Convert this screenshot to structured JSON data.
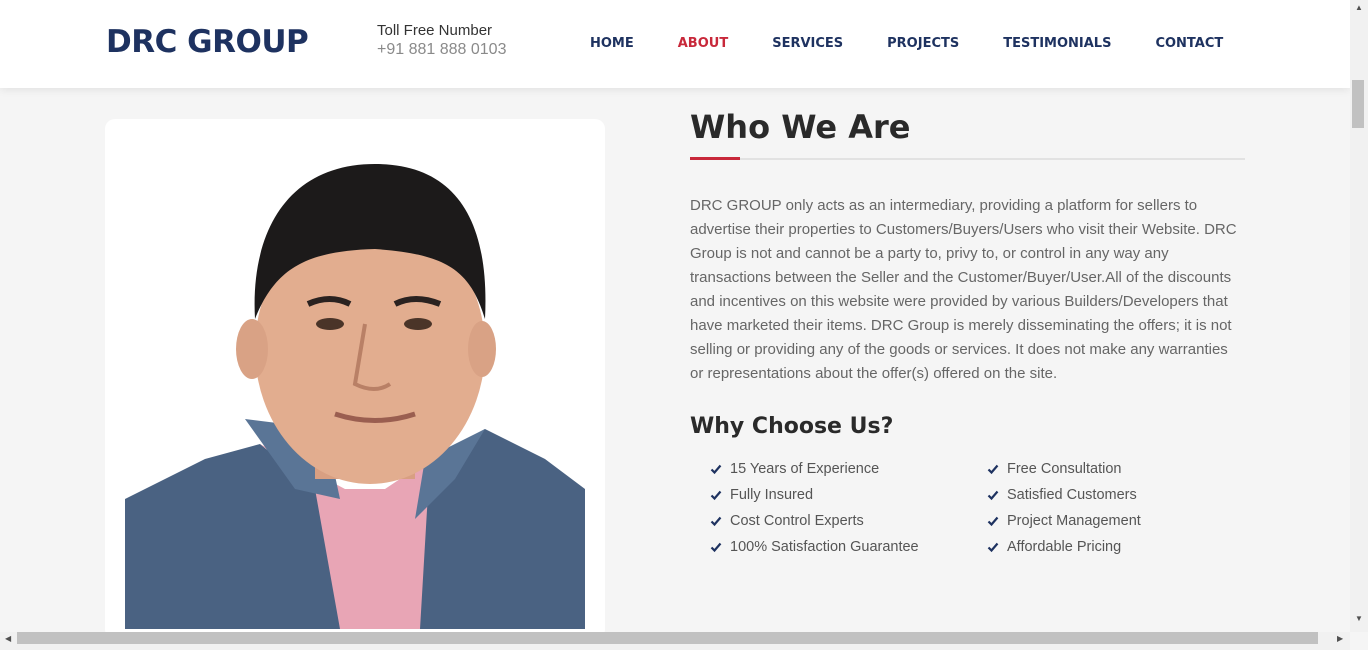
{
  "header": {
    "logo": "DRC GROUP",
    "toll_label": "Toll Free Number",
    "toll_number": "+91 881 888 0103",
    "nav": [
      {
        "label": "HOME",
        "active": false
      },
      {
        "label": "ABOUT",
        "active": true
      },
      {
        "label": "SERVICES",
        "active": false
      },
      {
        "label": "PROJECTS",
        "active": false
      },
      {
        "label": "TESTIMONIALS",
        "active": false
      },
      {
        "label": "CONTACT",
        "active": false
      }
    ]
  },
  "about": {
    "title": "Who We Are",
    "paragraph": "DRC GROUP only acts as an intermediary, providing a platform for sellers to advertise their properties to Customers/Buyers/Users who visit their Website. DRC Group is not and cannot be a party to, privy to, or control in any way any transactions between the Seller and the Customer/Buyer/User.All of the discounts and incentives on this website were provided by various Builders/Developers that have marketed their items. DRC Group is merely disseminating the offers; it is not selling or providing any of the goods or services. It does not make any warranties or representations about the offer(s) offered on the site.",
    "why_title": "Why Choose Us?",
    "features": [
      "15 Years of Experience",
      "Free Consultation",
      "Fully Insured",
      "Satisfied Customers",
      "Cost Control Experts",
      "Project Management",
      "100% Satisfaction Guarantee",
      "Affordable Pricing"
    ]
  },
  "colors": {
    "brand": "#1e3260",
    "accent": "#c8283a"
  },
  "icons": {
    "check": "check-icon",
    "photo": "person-photo"
  }
}
